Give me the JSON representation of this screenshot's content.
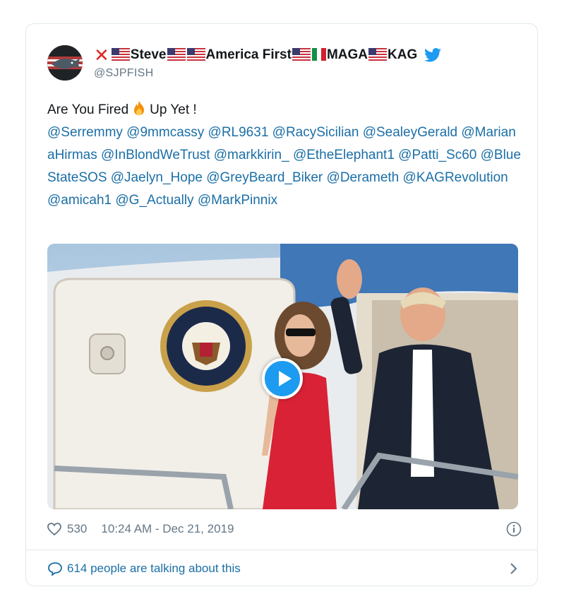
{
  "tweet": {
    "author": {
      "name_parts": [
        "Steve",
        "America First",
        "MAGA",
        "KAG"
      ],
      "handle": "@SJPFISH"
    },
    "text_intro": "Are You Fired",
    "text_after": "Up Yet !",
    "mentions": "@Serremmy @9mmcassy @RL9631 @RacySicilian @SealeyGerald @MarianaHirmas @InBlondWeTrust @markkirin_ @EtheElephant1 @Patti_Sc60 @BlueStateSOS @Jaelyn_Hope @GreyBeard_Biker @Derameth @KAGRevolution @amicah1 @G_Actually @MarkPinnix",
    "likes": "530",
    "timestamp": "10:24 AM - Dec 21, 2019",
    "talking": "614 people are talking about this"
  },
  "colors": {
    "link": "#1b6fa6",
    "twitter_blue": "#1d9bf0",
    "muted": "#657786",
    "red_x": "#e0281f"
  },
  "icons": [
    "twitter-bird-icon",
    "fire-emoji-icon",
    "us-flag-icon",
    "italy-flag-icon",
    "heart-icon",
    "info-icon",
    "speech-bubble-icon",
    "chevron-right-icon",
    "play-icon"
  ]
}
